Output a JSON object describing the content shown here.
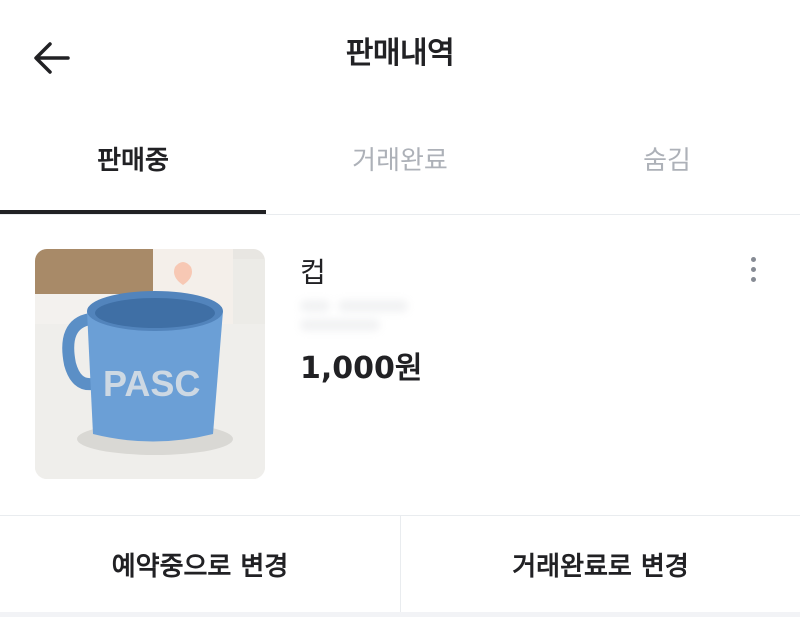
{
  "header": {
    "title": "판매내역",
    "back_icon": "arrow-left-icon"
  },
  "tabs": [
    {
      "label": "판매중",
      "active": true
    },
    {
      "label": "거래완료",
      "active": false
    },
    {
      "label": "숨김",
      "active": false
    }
  ],
  "item": {
    "title": "컵",
    "price": "1,000원",
    "image": "blue-mug-photo",
    "more_icon": "more-vertical-icon"
  },
  "actions": {
    "reserve_label": "예약중으로 변경",
    "complete_label": "거래완료로 변경"
  },
  "colors": {
    "text": "#212124",
    "inactive": "#adb1b8",
    "divider": "#e9ecef"
  }
}
